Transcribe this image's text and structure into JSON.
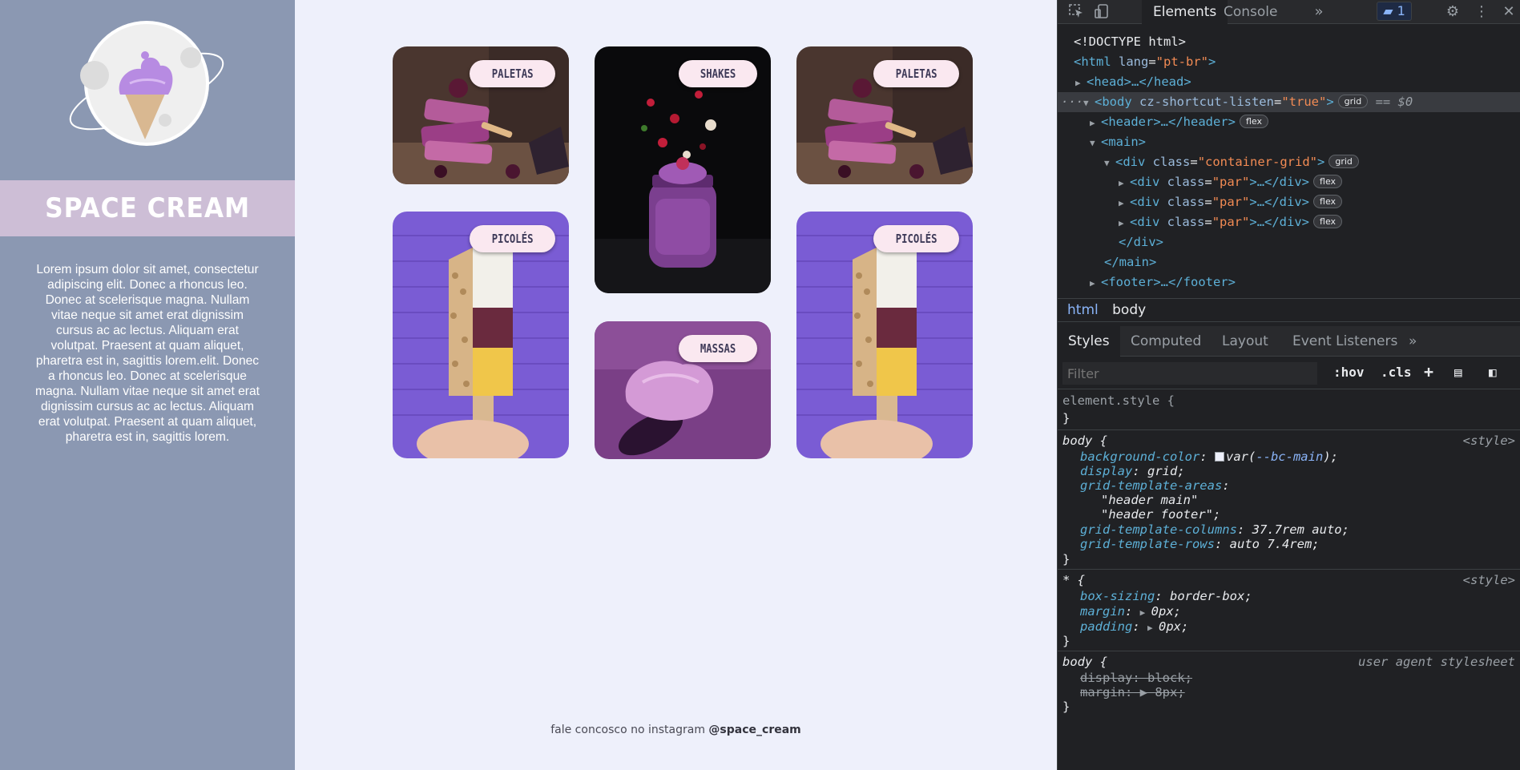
{
  "brand": {
    "title": "SPACE CREAM",
    "description": "Lorem ipsum dolor sit amet, consectetur adipiscing elit. Donec a rhoncus leo. Donec at scelerisque magna. Nullam vitae neque sit amet erat dignissim cursus ac ac lectus. Aliquam erat volutpat. Praesent at quam aliquet, pharetra est in, sagittis lorem.elit. Donec a rhoncus leo. Donec at scelerisque magna. Nullam vitae neque sit amet erat dignissim cursus ac ac lectus. Aliquam erat volutpat. Praesent at quam aliquet, pharetra est in, sagittis lorem."
  },
  "cards": [
    {
      "label": "PALETAS"
    },
    {
      "label": "SHAKES"
    },
    {
      "label": "PALETAS"
    },
    {
      "label": "PICOLÉS"
    },
    {
      "label": "MASSAS"
    },
    {
      "label": "PICOLÉS"
    }
  ],
  "footer": {
    "text": "fale concosco no instagram ",
    "handle": "@space_cream"
  },
  "devtools": {
    "tabs": [
      "Elements",
      "Console"
    ],
    "issues_count": "1",
    "dom": {
      "doctype": "<!DOCTYPE html>",
      "html_open": "<html ",
      "lang_attr": "lang",
      "lang_val": "\"pt-br\"",
      "head": "<head>…</head>",
      "body_open": "<body ",
      "body_attr": "cz-shortcut-listen",
      "body_val": "\"true\"",
      "body_chip": "grid",
      "body_eq": "== $0",
      "header": "<header>…</header>",
      "header_chip": "flex",
      "main_open": "<main>",
      "div_open": "<div ",
      "class_attr": "class",
      "grid_class_val": "\"container-grid\"",
      "grid_chip": "grid",
      "par_val": "\"par\"",
      "par_rest": ">…</div>",
      "par_chip": "flex",
      "div_close": "</div>",
      "main_close": "</main>",
      "footer": "<footer>…</footer>"
    },
    "breadcrumbs": [
      "html",
      "body"
    ],
    "sub_tabs": [
      "Styles",
      "Computed",
      "Layout",
      "Event Listeners"
    ],
    "filter_placeholder": "Filter",
    "filter_buttons": [
      ":hov",
      ".cls",
      "+"
    ],
    "styles": {
      "element_style": "element.style {",
      "close": "}",
      "body_sel": "body {",
      "style_src": "<style>",
      "ua_src": "user agent stylesheet",
      "star_sel": "* {",
      "bg_prop": "background-color",
      "bg_val_pre": "var(",
      "bg_var": "--bc-main",
      "bg_val_post": ");",
      "display_prop": "display",
      "display_val": "grid;",
      "gta_prop": "grid-template-areas",
      "gta_line1": "\"header main\"",
      "gta_line2": "\"header footer\";",
      "gtc_prop": "grid-template-columns",
      "gtc_val": "37.7rem auto;",
      "gtr_prop": "grid-template-rows",
      "gtr_val": "auto 7.4rem;",
      "bs_prop": "box-sizing",
      "bs_val": "border-box;",
      "margin_prop": "margin",
      "margin_val": "0px;",
      "padding_prop": "padding",
      "padding_val": "0px;",
      "ua_display_prop": "display",
      "ua_display_val": "block;",
      "ua_margin_prop": "margin",
      "ua_margin_val": "8px;"
    }
  }
}
